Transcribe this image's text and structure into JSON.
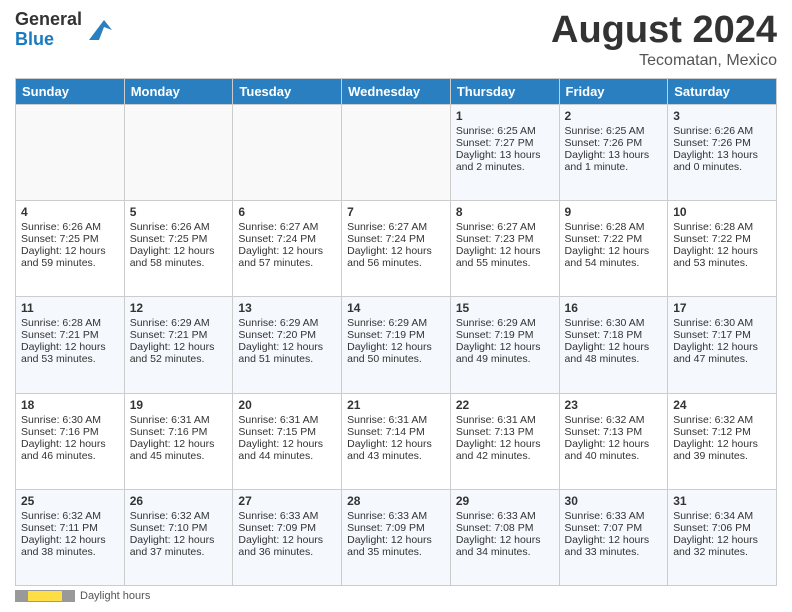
{
  "logo": {
    "general": "General",
    "blue": "Blue"
  },
  "header": {
    "month": "August 2024",
    "location": "Tecomatan, Mexico"
  },
  "days_of_week": [
    "Sunday",
    "Monday",
    "Tuesday",
    "Wednesday",
    "Thursday",
    "Friday",
    "Saturday"
  ],
  "weeks": [
    [
      {
        "day": "",
        "sunrise": "",
        "sunset": "",
        "daylight": ""
      },
      {
        "day": "",
        "sunrise": "",
        "sunset": "",
        "daylight": ""
      },
      {
        "day": "",
        "sunrise": "",
        "sunset": "",
        "daylight": ""
      },
      {
        "day": "",
        "sunrise": "",
        "sunset": "",
        "daylight": ""
      },
      {
        "day": "1",
        "sunrise": "Sunrise: 6:25 AM",
        "sunset": "Sunset: 7:27 PM",
        "daylight": "Daylight: 13 hours and 2 minutes."
      },
      {
        "day": "2",
        "sunrise": "Sunrise: 6:25 AM",
        "sunset": "Sunset: 7:26 PM",
        "daylight": "Daylight: 13 hours and 1 minute."
      },
      {
        "day": "3",
        "sunrise": "Sunrise: 6:26 AM",
        "sunset": "Sunset: 7:26 PM",
        "daylight": "Daylight: 13 hours and 0 minutes."
      }
    ],
    [
      {
        "day": "4",
        "sunrise": "Sunrise: 6:26 AM",
        "sunset": "Sunset: 7:25 PM",
        "daylight": "Daylight: 12 hours and 59 minutes."
      },
      {
        "day": "5",
        "sunrise": "Sunrise: 6:26 AM",
        "sunset": "Sunset: 7:25 PM",
        "daylight": "Daylight: 12 hours and 58 minutes."
      },
      {
        "day": "6",
        "sunrise": "Sunrise: 6:27 AM",
        "sunset": "Sunset: 7:24 PM",
        "daylight": "Daylight: 12 hours and 57 minutes."
      },
      {
        "day": "7",
        "sunrise": "Sunrise: 6:27 AM",
        "sunset": "Sunset: 7:24 PM",
        "daylight": "Daylight: 12 hours and 56 minutes."
      },
      {
        "day": "8",
        "sunrise": "Sunrise: 6:27 AM",
        "sunset": "Sunset: 7:23 PM",
        "daylight": "Daylight: 12 hours and 55 minutes."
      },
      {
        "day": "9",
        "sunrise": "Sunrise: 6:28 AM",
        "sunset": "Sunset: 7:22 PM",
        "daylight": "Daylight: 12 hours and 54 minutes."
      },
      {
        "day": "10",
        "sunrise": "Sunrise: 6:28 AM",
        "sunset": "Sunset: 7:22 PM",
        "daylight": "Daylight: 12 hours and 53 minutes."
      }
    ],
    [
      {
        "day": "11",
        "sunrise": "Sunrise: 6:28 AM",
        "sunset": "Sunset: 7:21 PM",
        "daylight": "Daylight: 12 hours and 53 minutes."
      },
      {
        "day": "12",
        "sunrise": "Sunrise: 6:29 AM",
        "sunset": "Sunset: 7:21 PM",
        "daylight": "Daylight: 12 hours and 52 minutes."
      },
      {
        "day": "13",
        "sunrise": "Sunrise: 6:29 AM",
        "sunset": "Sunset: 7:20 PM",
        "daylight": "Daylight: 12 hours and 51 minutes."
      },
      {
        "day": "14",
        "sunrise": "Sunrise: 6:29 AM",
        "sunset": "Sunset: 7:19 PM",
        "daylight": "Daylight: 12 hours and 50 minutes."
      },
      {
        "day": "15",
        "sunrise": "Sunrise: 6:29 AM",
        "sunset": "Sunset: 7:19 PM",
        "daylight": "Daylight: 12 hours and 49 minutes."
      },
      {
        "day": "16",
        "sunrise": "Sunrise: 6:30 AM",
        "sunset": "Sunset: 7:18 PM",
        "daylight": "Daylight: 12 hours and 48 minutes."
      },
      {
        "day": "17",
        "sunrise": "Sunrise: 6:30 AM",
        "sunset": "Sunset: 7:17 PM",
        "daylight": "Daylight: 12 hours and 47 minutes."
      }
    ],
    [
      {
        "day": "18",
        "sunrise": "Sunrise: 6:30 AM",
        "sunset": "Sunset: 7:16 PM",
        "daylight": "Daylight: 12 hours and 46 minutes."
      },
      {
        "day": "19",
        "sunrise": "Sunrise: 6:31 AM",
        "sunset": "Sunset: 7:16 PM",
        "daylight": "Daylight: 12 hours and 45 minutes."
      },
      {
        "day": "20",
        "sunrise": "Sunrise: 6:31 AM",
        "sunset": "Sunset: 7:15 PM",
        "daylight": "Daylight: 12 hours and 44 minutes."
      },
      {
        "day": "21",
        "sunrise": "Sunrise: 6:31 AM",
        "sunset": "Sunset: 7:14 PM",
        "daylight": "Daylight: 12 hours and 43 minutes."
      },
      {
        "day": "22",
        "sunrise": "Sunrise: 6:31 AM",
        "sunset": "Sunset: 7:13 PM",
        "daylight": "Daylight: 12 hours and 42 minutes."
      },
      {
        "day": "23",
        "sunrise": "Sunrise: 6:32 AM",
        "sunset": "Sunset: 7:13 PM",
        "daylight": "Daylight: 12 hours and 40 minutes."
      },
      {
        "day": "24",
        "sunrise": "Sunrise: 6:32 AM",
        "sunset": "Sunset: 7:12 PM",
        "daylight": "Daylight: 12 hours and 39 minutes."
      }
    ],
    [
      {
        "day": "25",
        "sunrise": "Sunrise: 6:32 AM",
        "sunset": "Sunset: 7:11 PM",
        "daylight": "Daylight: 12 hours and 38 minutes."
      },
      {
        "day": "26",
        "sunrise": "Sunrise: 6:32 AM",
        "sunset": "Sunset: 7:10 PM",
        "daylight": "Daylight: 12 hours and 37 minutes."
      },
      {
        "day": "27",
        "sunrise": "Sunrise: 6:33 AM",
        "sunset": "Sunset: 7:09 PM",
        "daylight": "Daylight: 12 hours and 36 minutes."
      },
      {
        "day": "28",
        "sunrise": "Sunrise: 6:33 AM",
        "sunset": "Sunset: 7:09 PM",
        "daylight": "Daylight: 12 hours and 35 minutes."
      },
      {
        "day": "29",
        "sunrise": "Sunrise: 6:33 AM",
        "sunset": "Sunset: 7:08 PM",
        "daylight": "Daylight: 12 hours and 34 minutes."
      },
      {
        "day": "30",
        "sunrise": "Sunrise: 6:33 AM",
        "sunset": "Sunset: 7:07 PM",
        "daylight": "Daylight: 12 hours and 33 minutes."
      },
      {
        "day": "31",
        "sunrise": "Sunrise: 6:34 AM",
        "sunset": "Sunset: 7:06 PM",
        "daylight": "Daylight: 12 hours and 32 minutes."
      }
    ]
  ],
  "footer": {
    "daylight_label": "Daylight hours"
  }
}
